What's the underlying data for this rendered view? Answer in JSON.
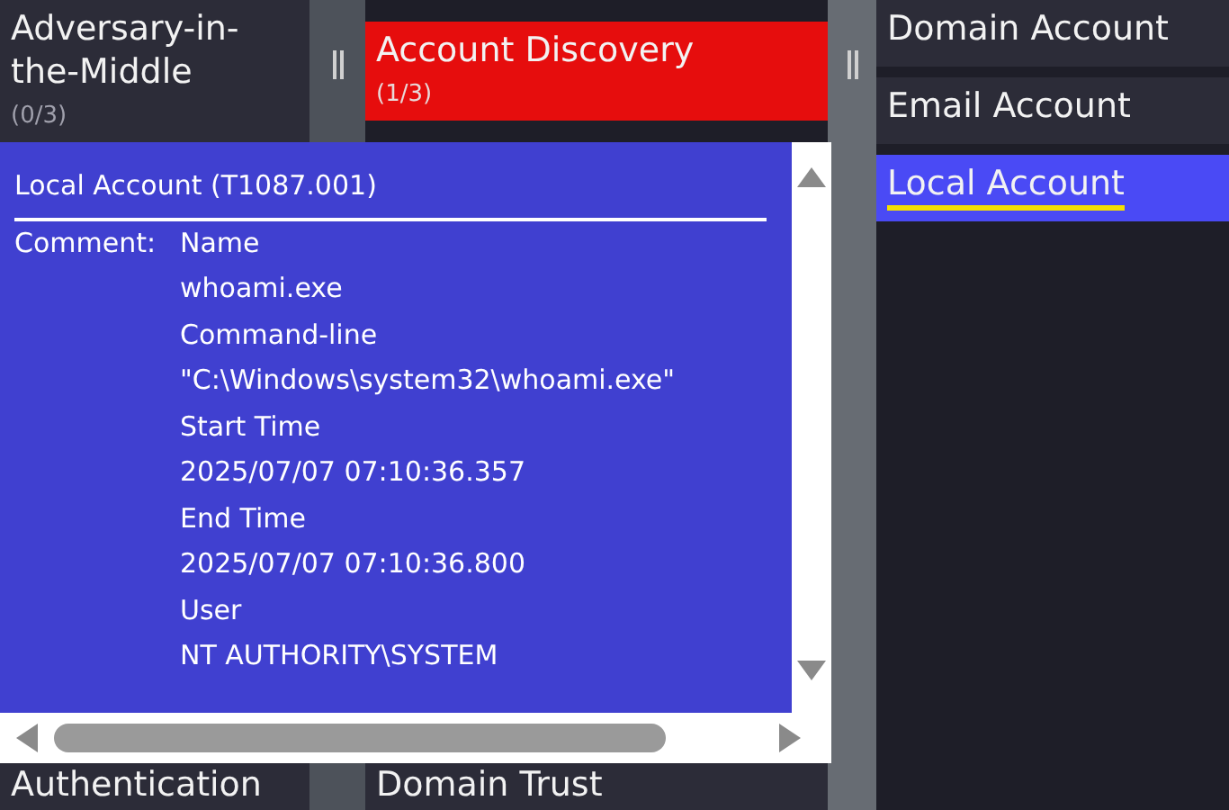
{
  "matrix": {
    "columns": [
      {
        "cells": [
          {
            "title": "Adversary-in- the-Middle",
            "count": "(0/3)",
            "selected": false
          },
          {
            "title": "Authentication",
            "selected": false
          }
        ]
      },
      {
        "cells": [
          {
            "title": "Account Discovery",
            "count": "(1/3)",
            "color": "#e60d0d",
            "selected": false
          },
          {
            "title": "Domain Trust",
            "selected": false
          }
        ]
      },
      {
        "cells": [
          {
            "title": "Domain Account",
            "selected": false
          },
          {
            "title": "Email Account",
            "selected": false
          },
          {
            "title": "Local Account",
            "selected": true
          }
        ]
      }
    ]
  },
  "popup": {
    "title": "Local Account (T1087.001)",
    "label": "Comment:",
    "lines": [
      "Name",
      "whoami.exe",
      "Command-line",
      "\"C:\\Windows\\system32\\whoami.exe\"",
      "Start Time",
      "2025/07/07 07:10:36.357",
      "End Time",
      "2025/07/07 07:10:36.800",
      "User",
      "NT AUTHORITY\\SYSTEM"
    ]
  }
}
